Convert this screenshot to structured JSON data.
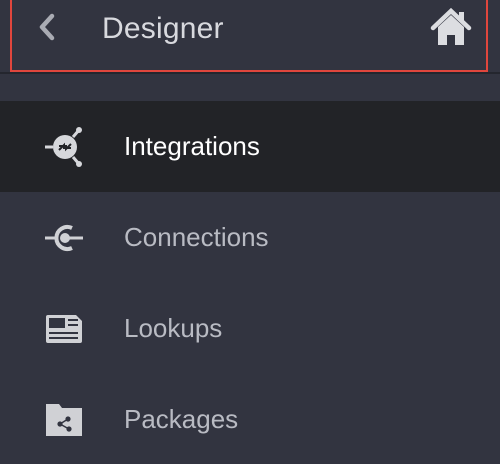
{
  "header": {
    "title": "Designer",
    "back_icon": "chevron-left-icon",
    "home_icon": "home-icon"
  },
  "menu": {
    "items": [
      {
        "label": "Integrations",
        "icon": "integrations-icon",
        "active": true
      },
      {
        "label": "Connections",
        "icon": "connections-icon",
        "active": false
      },
      {
        "label": "Lookups",
        "icon": "lookups-icon",
        "active": false
      },
      {
        "label": "Packages",
        "icon": "packages-icon",
        "active": false
      }
    ]
  },
  "colors": {
    "panel_bg": "#323440",
    "active_bg": "#222327",
    "highlight_outline": "#e0463d",
    "text_active": "#ffffff",
    "text_inactive": "#b9bbc3"
  }
}
